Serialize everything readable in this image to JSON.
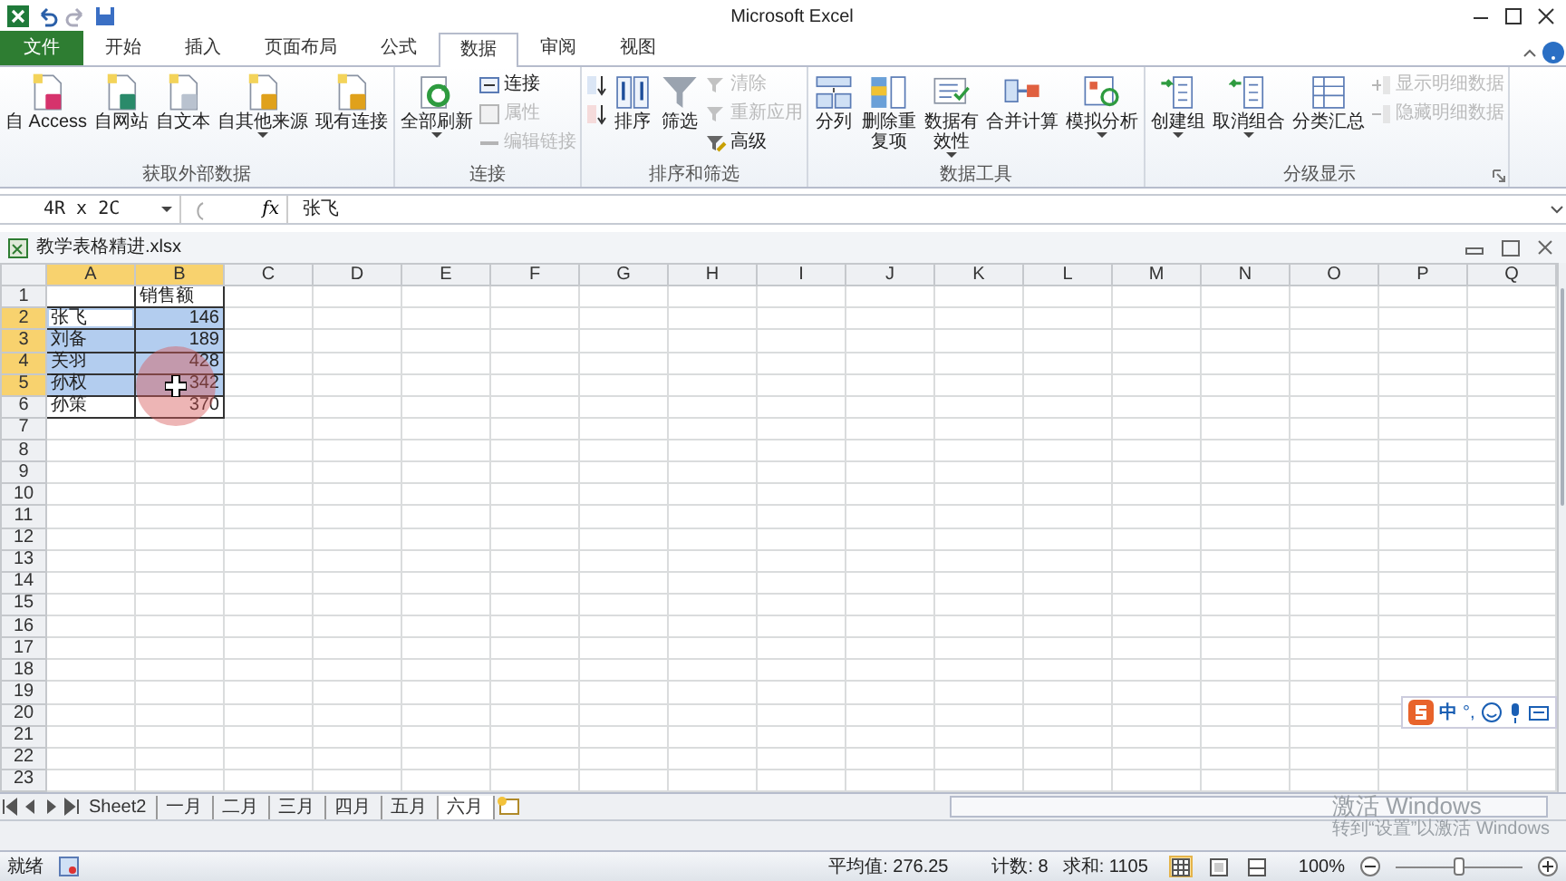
{
  "title_bar": {
    "title": "Microsoft Excel"
  },
  "ribbon_tabs": [
    {
      "label": "文件",
      "kind": "file",
      "selected": false
    },
    {
      "label": "开始",
      "kind": "tab",
      "selected": false
    },
    {
      "label": "插入",
      "kind": "tab",
      "selected": false
    },
    {
      "label": "页面布局",
      "kind": "tab",
      "selected": false
    },
    {
      "label": "公式",
      "kind": "tab",
      "selected": false
    },
    {
      "label": "数据",
      "kind": "tab",
      "selected": true
    },
    {
      "label": "审阅",
      "kind": "tab",
      "selected": false
    },
    {
      "label": "视图",
      "kind": "tab",
      "selected": false
    }
  ],
  "ribbon_groups": [
    {
      "label": "获取外部数据",
      "buttons": [
        {
          "kind": "large",
          "label": "自 Access",
          "disabled": false
        },
        {
          "kind": "large",
          "label": "自网站",
          "disabled": false
        },
        {
          "kind": "large",
          "label": "自文本",
          "disabled": false
        },
        {
          "kind": "large",
          "label": "自其他来源",
          "dropdown": true,
          "disabled": false
        },
        {
          "kind": "large",
          "label": "现有连接",
          "disabled": false
        }
      ]
    },
    {
      "label": "连接",
      "buttons": [
        {
          "kind": "large",
          "label": "全部刷新",
          "dropdown": true,
          "disabled": false
        },
        {
          "kind": "small",
          "label": "连接",
          "disabled": false
        },
        {
          "kind": "small",
          "label": "属性",
          "disabled": true
        },
        {
          "kind": "small",
          "label": "编辑链接",
          "disabled": true
        }
      ]
    },
    {
      "label": "排序和筛选",
      "buttons": [
        {
          "kind": "icon",
          "disabled": false
        },
        {
          "kind": "icon",
          "disabled": false
        },
        {
          "kind": "large",
          "label": "排序",
          "disabled": false
        },
        {
          "kind": "large",
          "label": "筛选",
          "disabled": false
        },
        {
          "kind": "small",
          "label": "清除",
          "disabled": true
        },
        {
          "kind": "small",
          "label": "重新应用",
          "disabled": true
        },
        {
          "kind": "small",
          "label": "高级",
          "disabled": false
        }
      ]
    },
    {
      "label": "数据工具",
      "buttons": [
        {
          "kind": "large",
          "label": "分列",
          "disabled": false
        },
        {
          "kind": "large",
          "label": "删除重复项",
          "disabled": false
        },
        {
          "kind": "large",
          "label": "数据有效性",
          "dropdown": true,
          "disabled": false
        },
        {
          "kind": "large",
          "label": "合并计算",
          "disabled": false
        },
        {
          "kind": "large",
          "label": "模拟分析",
          "dropdown": true,
          "disabled": false
        }
      ]
    },
    {
      "label": "分级显示",
      "launcher": true,
      "buttons": [
        {
          "kind": "large",
          "label": "创建组",
          "dropdown": true,
          "disabled": false
        },
        {
          "kind": "large",
          "label": "取消组合",
          "dropdown": true,
          "disabled": false
        },
        {
          "kind": "large",
          "label": "分类汇总",
          "disabled": false
        },
        {
          "kind": "small",
          "label": "显示明细数据",
          "disabled": true
        },
        {
          "kind": "small",
          "label": "隐藏明细数据",
          "disabled": true
        }
      ]
    }
  ],
  "formula_bar": {
    "name_box": "4R x 2C",
    "function_label": "fx",
    "formula": "张飞"
  },
  "workbook": {
    "title": "教学表格精进.xlsx"
  },
  "sheet": {
    "columns": [
      {
        "label": "A",
        "selected": true
      },
      {
        "label": "B",
        "selected": true
      },
      {
        "label": "C",
        "selected": false
      },
      {
        "label": "D",
        "selected": false
      },
      {
        "label": "E",
        "selected": false
      },
      {
        "label": "F",
        "selected": false
      },
      {
        "label": "G",
        "selected": false
      },
      {
        "label": "H",
        "selected": false
      },
      {
        "label": "I",
        "selected": false
      },
      {
        "label": "J",
        "selected": false
      },
      {
        "label": "K",
        "selected": false
      },
      {
        "label": "L",
        "selected": false
      },
      {
        "label": "M",
        "selected": false
      },
      {
        "label": "N",
        "selected": false
      },
      {
        "label": "O",
        "selected": false
      },
      {
        "label": "P",
        "selected": false
      },
      {
        "label": "Q",
        "selected": false
      }
    ],
    "rows": [
      {
        "number": "1",
        "selected": false,
        "cells": [
          {
            "kind": "text",
            "selected": false,
            "active": false
          },
          {
            "kind": "text",
            "text": "销售额",
            "selected": false,
            "active": false
          }
        ]
      },
      {
        "number": "2",
        "selected": true,
        "cells": [
          {
            "kind": "text",
            "text": "张飞",
            "selected": true,
            "active": true
          },
          {
            "kind": "number",
            "text": "146",
            "selected": true,
            "active": false
          }
        ]
      },
      {
        "number": "3",
        "selected": true,
        "cells": [
          {
            "kind": "text",
            "text": "刘备",
            "selected": true,
            "active": false
          },
          {
            "kind": "number",
            "text": "189",
            "selected": true,
            "active": false
          }
        ]
      },
      {
        "number": "4",
        "selected": true,
        "cells": [
          {
            "kind": "text",
            "text": "关羽",
            "selected": true,
            "active": false
          },
          {
            "kind": "number",
            "text": "428",
            "selected": true,
            "active": false
          }
        ]
      },
      {
        "number": "5",
        "selected": true,
        "cells": [
          {
            "kind": "text",
            "text": "孙权",
            "selected": true,
            "active": false
          },
          {
            "kind": "number",
            "text": "342",
            "selected": true,
            "active": false
          }
        ]
      },
      {
        "number": "6",
        "selected": false,
        "cells": [
          {
            "kind": "text",
            "text": "孙策",
            "selected": false,
            "active": false
          },
          {
            "kind": "number",
            "text": "370",
            "selected": false,
            "active": false
          }
        ]
      },
      {
        "number": "7",
        "selected": false
      },
      {
        "number": "8",
        "selected": false
      },
      {
        "number": "9",
        "selected": false
      },
      {
        "number": "10",
        "selected": false
      },
      {
        "number": "11",
        "selected": false
      },
      {
        "number": "12",
        "selected": false
      },
      {
        "number": "13",
        "selected": false
      },
      {
        "number": "14",
        "selected": false
      },
      {
        "number": "15",
        "selected": false
      },
      {
        "number": "16",
        "selected": false
      },
      {
        "number": "17",
        "selected": false
      },
      {
        "number": "18",
        "selected": false
      },
      {
        "number": "19",
        "selected": false
      },
      {
        "number": "20",
        "selected": false
      },
      {
        "number": "21",
        "selected": false
      },
      {
        "number": "22",
        "selected": false
      },
      {
        "number": "23",
        "selected": false
      }
    ]
  },
  "sheet_tabs": [
    {
      "label": "Sheet2",
      "selected": false
    },
    {
      "label": "一月",
      "selected": false
    },
    {
      "label": "二月",
      "selected": false
    },
    {
      "label": "三月",
      "selected": false
    },
    {
      "label": "四月",
      "selected": false
    },
    {
      "label": "五月",
      "selected": false
    },
    {
      "label": "六月",
      "selected": true
    }
  ],
  "ime_toolbar": {
    "mode": "中",
    "punctuation": "°,"
  },
  "activation_notice": {
    "title": "激活 Windows",
    "hint": "转到“设置”以激活 Windows"
  },
  "status_bar": {
    "state": "就绪",
    "average": "平均值: 276.25",
    "count": "计数: 8",
    "sum": "求和: 1105",
    "views": [
      {
        "selected": true
      },
      {
        "selected": false
      },
      {
        "selected": false
      }
    ],
    "zoom": "100%",
    "zoom_slider": {
      "level": 0.5
    }
  }
}
